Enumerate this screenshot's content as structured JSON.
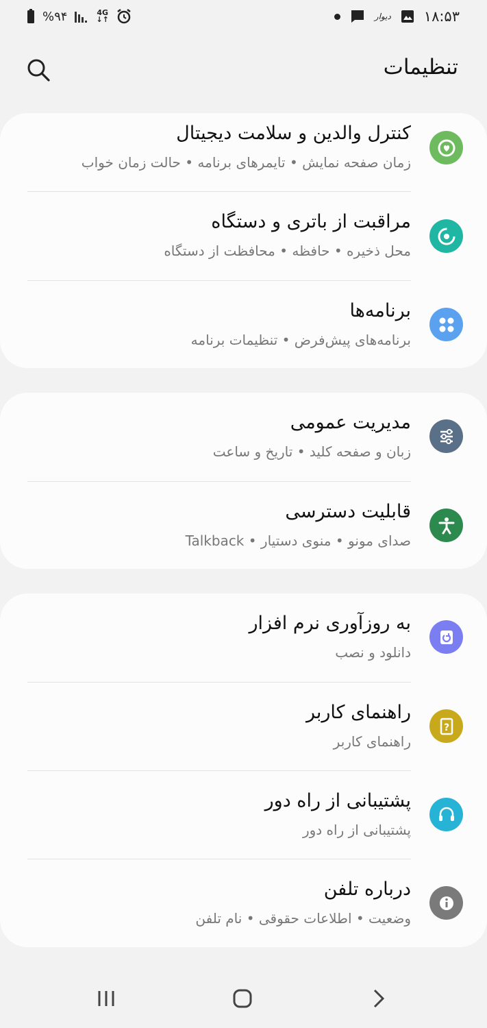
{
  "status_bar": {
    "time": "۱۸:۵۳",
    "notification_app": "دیوار",
    "battery_percent": "%۹۴",
    "network": "4G"
  },
  "header": {
    "title": "تنظیمات"
  },
  "groups": [
    {
      "items": [
        {
          "title": "کنترل والدین و سلامت دیجیتال",
          "subtitle": "زمان صفحه نمایش  •  تایمرهای برنامه  •  حالت زمان خواب",
          "icon": "digital-wellbeing-icon",
          "color": "#6dbb5e"
        },
        {
          "title": "مراقبت از باتری و دستگاه",
          "subtitle": "محل ذخیره  •  حافظه  •  محافظت از دستگاه",
          "icon": "device-care-icon",
          "color": "#1fb7a3"
        },
        {
          "title": "برنامه‌ها",
          "subtitle": "برنامه‌های پیش‌فرض  •  تنظیمات برنامه",
          "icon": "apps-icon",
          "color": "#5aa2f0"
        }
      ]
    },
    {
      "items": [
        {
          "title": "مدیریت عمومی",
          "subtitle": "زبان و صفحه کلید  •  تاریخ و ساعت",
          "icon": "general-management-icon",
          "color": "#5a6f88"
        },
        {
          "title": "قابلیت دسترسی",
          "subtitle": "صدای مونو  •  منوی دستیار  •  Talkback",
          "icon": "accessibility-icon",
          "color": "#2d8a4f"
        }
      ]
    },
    {
      "items": [
        {
          "title": "به روزآوری نرم افزار",
          "subtitle": "دانلود و نصب",
          "icon": "software-update-icon",
          "color": "#7b7ef0"
        },
        {
          "title": "راهنمای کاربر",
          "subtitle": "راهنمای کاربر",
          "icon": "user-manual-icon",
          "color": "#c9a91c"
        },
        {
          "title": "پشتیبانی از راه دور",
          "subtitle": "پشتیبانی از راه دور",
          "icon": "remote-support-icon",
          "color": "#27b3d6"
        },
        {
          "title": "درباره تلفن",
          "subtitle": "وضعیت  •  اطلاعات حقوقی  •  نام تلفن",
          "icon": "info-icon",
          "color": "#7a7a7a"
        }
      ]
    }
  ],
  "navbar": {
    "recent": "recent-apps-icon",
    "home": "home-icon",
    "back": "back-icon"
  }
}
